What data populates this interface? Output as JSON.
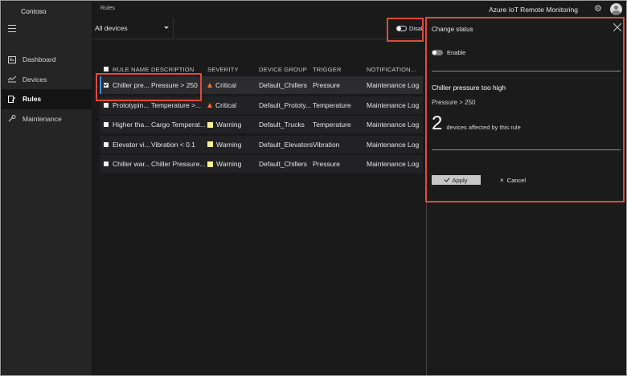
{
  "app": {
    "brand": "Contoso",
    "breadcrumb": "Rules",
    "title": "Azure IoT Remote Monitoring"
  },
  "sidebar": {
    "items": [
      {
        "label": "Dashboard",
        "icon": "dashboard-icon",
        "active": false
      },
      {
        "label": "Devices",
        "icon": "devices-icon",
        "active": false
      },
      {
        "label": "Rules",
        "icon": "rules-icon",
        "active": true
      },
      {
        "label": "Maintenance",
        "icon": "maintenance-icon",
        "active": false
      }
    ]
  },
  "toolbar": {
    "filter_value": "All devices",
    "toggle_label": "Disable"
  },
  "grid": {
    "headers": {
      "name": "RULE NAME",
      "description": "DESCRIPTION",
      "severity": "SEVERITY",
      "group": "DEVICE GROUP",
      "trigger": "TRIGGER",
      "notification": "NOTIFICATION..."
    },
    "rows": [
      {
        "name": "Chiller pre...",
        "description": "Pressure > 250",
        "severity": "Critical",
        "group": "Default_Chillers",
        "trigger": "Pressure",
        "notification": "Maintenance Log",
        "checked": true
      },
      {
        "name": "Prototypin...",
        "description": "Temperature >...",
        "severity": "Critical",
        "group": "Default_Prototy...",
        "trigger": "Temperature",
        "notification": "Maintenance Log",
        "checked": false
      },
      {
        "name": "Higher tha...",
        "description": "Cargo Temperat...",
        "severity": "Warning",
        "group": "Default_Trucks",
        "trigger": "Temperature",
        "notification": "Maintenance Log",
        "checked": false
      },
      {
        "name": "Elevator vi...",
        "description": "Vibration < 0.1",
        "severity": "Warning",
        "group": "Default_Elevators",
        "trigger": "Vibration",
        "notification": "Maintenance Log",
        "checked": false
      },
      {
        "name": "Chiller war...",
        "description": "Chiller Pressure...",
        "severity": "Warning",
        "group": "Default_Chillers",
        "trigger": "Pressure",
        "notification": "Maintenance Log",
        "checked": false
      }
    ]
  },
  "flyout": {
    "title": "Change status",
    "enable_label": "Enable",
    "rule_name": "Chiller pressure too high",
    "rule_condition": "Pressure > 250",
    "affected_count": "2",
    "affected_label": "devices affected by this rule",
    "apply_label": "Apply",
    "cancel_label": "Cancel"
  },
  "colors": {
    "critical": "#ff6a2a",
    "warning": "#fff38a",
    "selection_accent": "#3b8fdc",
    "callout": "#e14a3c"
  }
}
